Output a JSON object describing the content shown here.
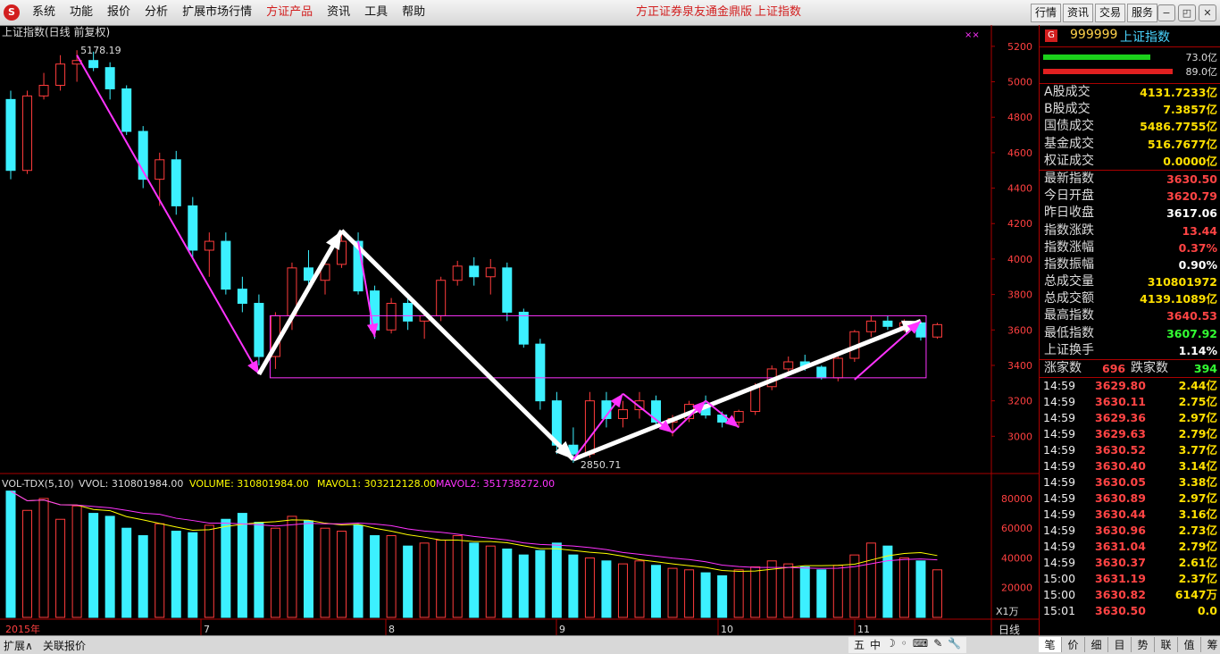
{
  "menu": {
    "items": [
      "系统",
      "功能",
      "报价",
      "分析",
      "扩展市场行情",
      "方证产品",
      "资讯",
      "工具",
      "帮助"
    ],
    "brand1": "方正证券泉友通金鼎版",
    "brand2": "上证指数",
    "right": [
      "行情",
      "资讯",
      "交易",
      "服务"
    ]
  },
  "chart": {
    "title": "上证指数(日线 前复权)",
    "high_label": "5178.19",
    "low_label": "2850.71",
    "vol_header": {
      "name": "VOL-TDX(5,10)",
      "vvol": "VVOL: 310801984.00",
      "volume": "VOLUME: 310801984.00",
      "mavol1": "MAVOL1: 303212128.00",
      "mavol2": "MAVOL2: 351738272.00"
    },
    "unit": "X1万",
    "period": "日线",
    "year_label": "2015年",
    "months": [
      {
        "label": "7",
        "x": 225
      },
      {
        "label": "8",
        "x": 432
      },
      {
        "label": "9",
        "x": 623
      },
      {
        "label": "10",
        "x": 804
      },
      {
        "label": "11",
        "x": 957
      }
    ],
    "price_ticks": [
      "5200",
      "5000",
      "4800",
      "4600",
      "4400",
      "4200",
      "4000",
      "3800",
      "3600",
      "3400",
      "3200",
      "3000"
    ],
    "vol_ticks": [
      "80000",
      "60000",
      "40000",
      "20000"
    ],
    "colors": {
      "up": "#ff3c3c",
      "down": "#3cf0ff",
      "magenta": "#ff33ff",
      "ma1": "#ffff00",
      "ma2": "#ff33ff"
    }
  },
  "chart_data": {
    "type": "candlestick",
    "ohlc": [
      [
        4900,
        4950,
        4450,
        4500
      ],
      [
        4500,
        4950,
        4480,
        4920
      ],
      [
        4920,
        5050,
        4900,
        4980
      ],
      [
        4980,
        5150,
        4950,
        5100
      ],
      [
        5100,
        5178,
        5000,
        5120
      ],
      [
        5120,
        5170,
        5060,
        5080
      ],
      [
        5080,
        5110,
        4900,
        4960
      ],
      [
        4960,
        4980,
        4700,
        4720
      ],
      [
        4720,
        4750,
        4400,
        4450
      ],
      [
        4450,
        4600,
        4300,
        4560
      ],
      [
        4560,
        4610,
        4250,
        4300
      ],
      [
        4300,
        4350,
        4000,
        4050
      ],
      [
        4050,
        4150,
        3900,
        4100
      ],
      [
        4100,
        4150,
        3800,
        3830
      ],
      [
        3830,
        3900,
        3700,
        3750
      ],
      [
        3750,
        3800,
        3400,
        3450
      ],
      [
        3450,
        3700,
        3380,
        3680
      ],
      [
        3680,
        3980,
        3600,
        3950
      ],
      [
        3950,
        4050,
        3850,
        3880
      ],
      [
        3880,
        4000,
        3800,
        3970
      ],
      [
        3970,
        4150,
        3950,
        4100
      ],
      [
        4100,
        4150,
        3800,
        3820
      ],
      [
        3820,
        3850,
        3550,
        3600
      ],
      [
        3600,
        3780,
        3580,
        3750
      ],
      [
        3750,
        3780,
        3600,
        3650
      ],
      [
        3650,
        3700,
        3550,
        3680
      ],
      [
        3680,
        3900,
        3650,
        3880
      ],
      [
        3880,
        3990,
        3850,
        3960
      ],
      [
        3960,
        4010,
        3850,
        3900
      ],
      [
        3900,
        4000,
        3800,
        3950
      ],
      [
        3950,
        3980,
        3650,
        3700
      ],
      [
        3700,
        3720,
        3500,
        3520
      ],
      [
        3520,
        3550,
        3150,
        3200
      ],
      [
        3200,
        3250,
        2900,
        2950
      ],
      [
        2950,
        3050,
        2850,
        2900
      ],
      [
        2900,
        3250,
        2880,
        3200
      ],
      [
        3200,
        3250,
        3050,
        3100
      ],
      [
        3100,
        3200,
        3050,
        3150
      ],
      [
        3150,
        3250,
        3100,
        3200
      ],
      [
        3200,
        3230,
        3050,
        3080
      ],
      [
        3080,
        3120,
        3000,
        3100
      ],
      [
        3100,
        3200,
        3080,
        3180
      ],
      [
        3180,
        3230,
        3100,
        3120
      ],
      [
        3120,
        3140,
        3050,
        3080
      ],
      [
        3080,
        3150,
        3050,
        3140
      ],
      [
        3140,
        3300,
        3120,
        3280
      ],
      [
        3280,
        3400,
        3260,
        3380
      ],
      [
        3380,
        3450,
        3350,
        3420
      ],
      [
        3420,
        3460,
        3370,
        3390
      ],
      [
        3390,
        3400,
        3320,
        3330
      ],
      [
        3330,
        3450,
        3310,
        3440
      ],
      [
        3440,
        3600,
        3420,
        3590
      ],
      [
        3590,
        3680,
        3560,
        3650
      ],
      [
        3650,
        3680,
        3600,
        3620
      ],
      [
        3620,
        3660,
        3590,
        3640
      ],
      [
        3640,
        3650,
        3540,
        3560
      ],
      [
        3560,
        3640,
        3550,
        3630
      ]
    ],
    "volume": [
      85,
      72,
      80,
      66,
      75,
      70,
      68,
      60,
      55,
      63,
      58,
      57,
      62,
      66,
      70,
      64,
      60,
      68,
      65,
      60,
      58,
      62,
      55,
      55,
      48,
      50,
      52,
      55,
      50,
      48,
      46,
      42,
      45,
      50,
      42,
      40,
      38,
      36,
      38,
      35,
      33,
      32,
      30,
      28,
      32,
      34,
      38,
      36,
      34,
      32,
      35,
      42,
      50,
      48,
      40,
      38,
      32
    ],
    "annotations": [
      {
        "label": "5178.19",
        "y": 5178.19
      },
      {
        "label": "2850.71",
        "y": 2850.71
      }
    ],
    "ylim": [
      2800,
      5300
    ]
  },
  "side": {
    "code": "999999",
    "name": "上证指数",
    "bar1": "73.0亿",
    "bar2": "89.0亿",
    "rows": [
      {
        "l": "A股成交",
        "r": "4131.7233亿",
        "c": "#ffe000"
      },
      {
        "l": "B股成交",
        "r": "7.3857亿",
        "c": "#ffe000"
      },
      {
        "l": "国债成交",
        "r": "5486.7755亿",
        "c": "#ffe000"
      },
      {
        "l": "基金成交",
        "r": "516.7677亿",
        "c": "#ffe000"
      },
      {
        "l": "权证成交",
        "r": "0.0000亿",
        "c": "#ffe000"
      }
    ],
    "rows2": [
      {
        "l": "最新指数",
        "r": "3630.50",
        "c": "#ff4444"
      },
      {
        "l": "今日开盘",
        "r": "3620.79",
        "c": "#ff4444"
      },
      {
        "l": "昨日收盘",
        "r": "3617.06",
        "c": "#ffffff"
      },
      {
        "l": "指数涨跌",
        "r": "13.44",
        "c": "#ff4444"
      },
      {
        "l": "指数涨幅",
        "r": "0.37%",
        "c": "#ff4444"
      },
      {
        "l": "指数振幅",
        "r": "0.90%",
        "c": "#ffffff"
      },
      {
        "l": "总成交量",
        "r": "310801972",
        "c": "#ffe000"
      },
      {
        "l": "总成交额",
        "r": "4139.1089亿",
        "c": "#ffe000"
      },
      {
        "l": "最高指数",
        "r": "3640.53",
        "c": "#ff4444"
      },
      {
        "l": "最低指数",
        "r": "3607.92",
        "c": "#33ff33"
      },
      {
        "l": "上证换手",
        "r": "1.14%",
        "c": "#ffffff"
      }
    ],
    "up_label": "涨家数",
    "up_value": "696",
    "down_label": "跌家数",
    "down_value": "394",
    "ticks": [
      [
        "14:59",
        "3629.80",
        "2.44亿"
      ],
      [
        "14:59",
        "3630.11",
        "2.75亿"
      ],
      [
        "14:59",
        "3629.36",
        "2.97亿"
      ],
      [
        "14:59",
        "3629.63",
        "2.79亿"
      ],
      [
        "14:59",
        "3630.52",
        "3.77亿"
      ],
      [
        "14:59",
        "3630.40",
        "3.14亿"
      ],
      [
        "14:59",
        "3630.05",
        "3.38亿"
      ],
      [
        "14:59",
        "3630.89",
        "2.97亿"
      ],
      [
        "14:59",
        "3630.44",
        "3.16亿"
      ],
      [
        "14:59",
        "3630.96",
        "2.73亿"
      ],
      [
        "14:59",
        "3631.04",
        "2.79亿"
      ],
      [
        "14:59",
        "3630.37",
        "2.61亿"
      ],
      [
        "15:00",
        "3631.19",
        "2.37亿"
      ],
      [
        "15:00",
        "3630.82",
        "6147万"
      ],
      [
        "15:01",
        "3630.50",
        "0.0"
      ]
    ]
  },
  "status": {
    "left1": "扩展∧",
    "left2": "关联报价",
    "ime": [
      "五",
      "中",
      "☽",
      "◦",
      "⌨",
      "✎",
      "🔧"
    ],
    "tabs": [
      "笔",
      "价",
      "细",
      "目",
      "势",
      "联",
      "值",
      "筹"
    ]
  }
}
